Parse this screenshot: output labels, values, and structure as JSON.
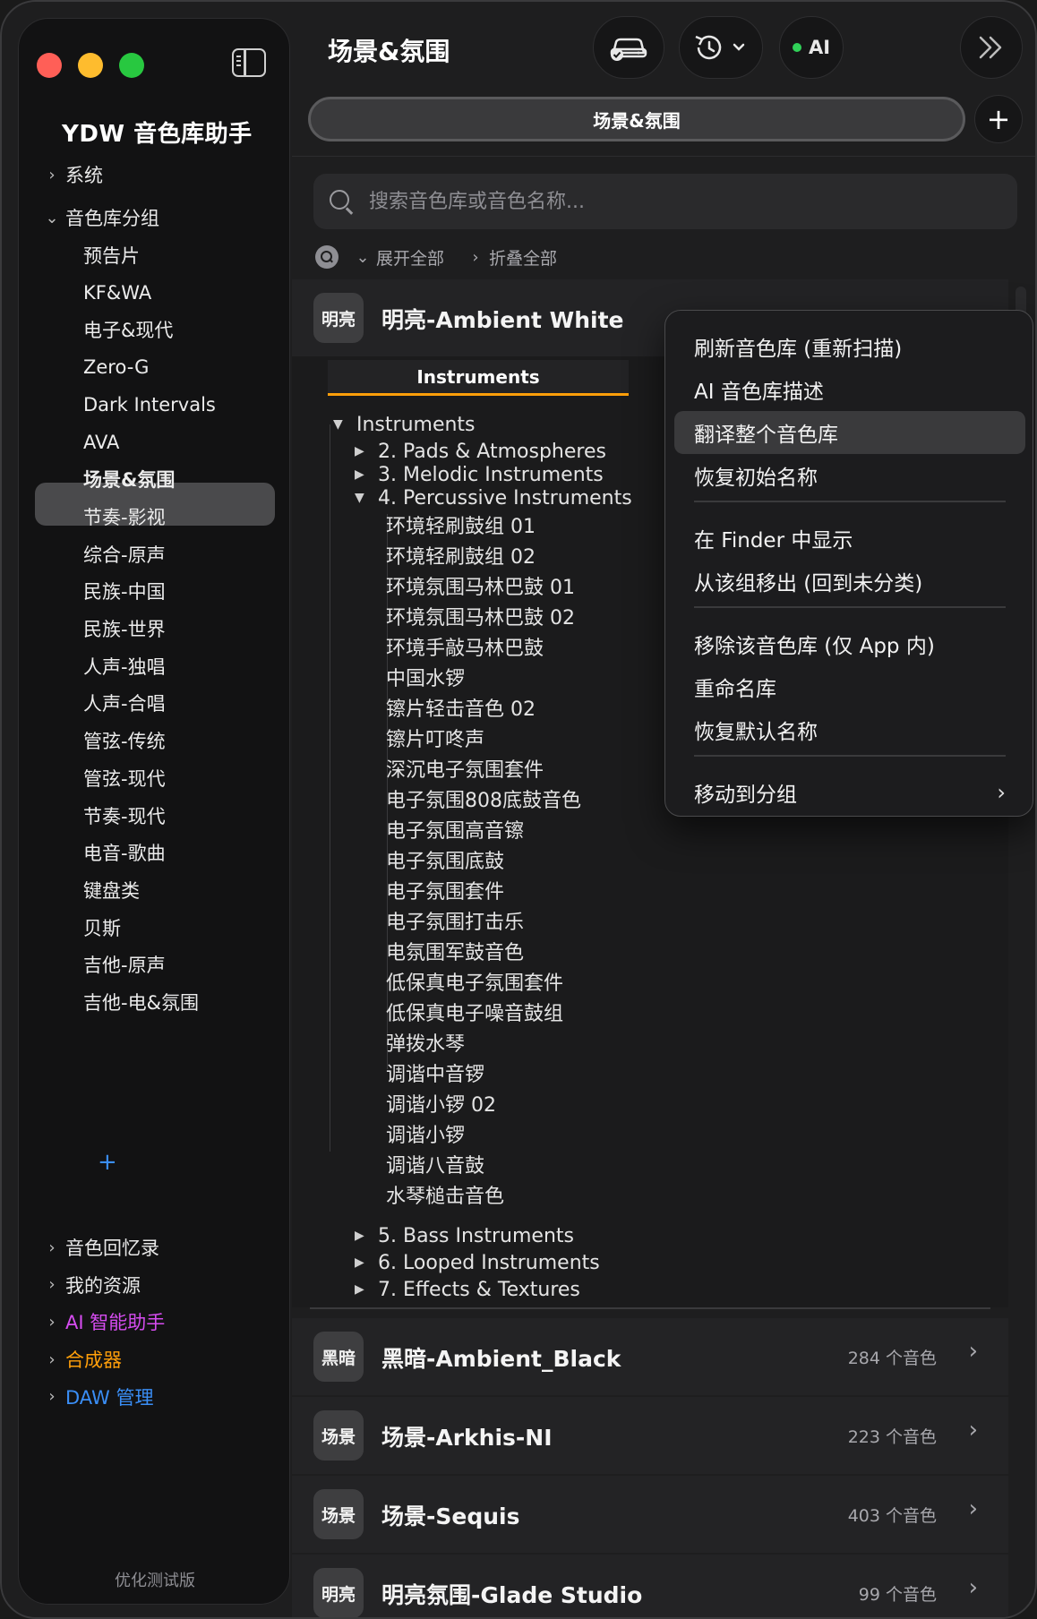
{
  "sidebar": {
    "app_title": "YDW 音色库助手",
    "system": "系统",
    "groups_label": "音色库分组",
    "groups": [
      "预告片",
      "KF&WA",
      "电子&现代",
      "Zero-G",
      "Dark Intervals",
      "AVA",
      "场景&氛围",
      "节奏-影视",
      "综合-原声",
      "民族-中国",
      "民族-世界",
      "人声-独唱",
      "人声-合唱",
      "管弦-传统",
      "管弦-现代",
      "节奏-现代",
      "电音-歌曲",
      "键盘类",
      "贝斯",
      "吉他-原声",
      "吉他-电&氛围"
    ],
    "selected_group": "场景&氛围",
    "add_symbol": "+",
    "sections": [
      {
        "label": "音色回忆录",
        "color": "#e8e8e8"
      },
      {
        "label": "我的资源",
        "color": "#e8e8e8"
      },
      {
        "label": "AI 智能助手",
        "color": "#d64cf0"
      },
      {
        "label": "合成器",
        "color": "#ff9f0a"
      },
      {
        "label": "DAW 管理",
        "color": "#3a8ef6"
      }
    ],
    "footer": "优化测试版"
  },
  "header": {
    "title": "场景&氛围",
    "ai_label": "AI",
    "tab_label": "场景&氛围",
    "add_tab": "+"
  },
  "search": {
    "placeholder": "搜索音色库或音色名称..."
  },
  "filters": {
    "expand_all": "展开全部",
    "collapse_all": "折叠全部"
  },
  "expanded_library": {
    "badge": "明亮",
    "name": "明亮-Ambient White",
    "tab": "Instruments",
    "root": "Instruments",
    "folders_before": [
      "2. Pads & Atmospheres",
      "3. Melodic Instruments"
    ],
    "open_folder": "4. Percussive Instruments",
    "items": [
      "环境轻刷鼓组 01",
      "环境轻刷鼓组 02",
      "环境氛围马林巴鼓 01",
      "环境氛围马林巴鼓 02",
      "环境手敲马林巴鼓",
      "中国水锣",
      "镲片轻击音色 02",
      "镲片叮咚声",
      "深沉电子氛围套件",
      "电子氛围808底鼓音色",
      "电子氛围高音镲",
      "电子氛围底鼓",
      "电子氛围套件",
      "电子氛围打击乐",
      "电氛围军鼓音色",
      "低保真电子氛围套件",
      "低保真电子噪音鼓组",
      "弹拨水琴",
      "调谐中音锣",
      "调谐小锣 02",
      "调谐小锣",
      "调谐八音鼓",
      "水琴槌击音色"
    ],
    "folders_after": [
      "5. Bass Instruments",
      "6. Looped Instruments",
      "7. Effects & Textures"
    ]
  },
  "libraries": [
    {
      "badge": "黑暗",
      "name": "黑暗-Ambient_Black",
      "count": "284 个音色"
    },
    {
      "badge": "场景",
      "name": "场景-Arkhis-NI",
      "count": "223 个音色"
    },
    {
      "badge": "场景",
      "name": "场景-Sequis",
      "count": "403 个音色"
    },
    {
      "badge": "明亮",
      "name": "明亮氛围-Glade Studio",
      "count": "99 个音色"
    }
  ],
  "context_menu": {
    "items": [
      "刷新音色库 (重新扫描)",
      "AI 音色库描述",
      "翻译整个音色库",
      "恢复初始名称",
      "在 Finder 中显示",
      "从该组移出 (回到未分类)",
      "移除该音色库 (仅 App 内)",
      "重命名库",
      "恢复默认名称",
      "移动到分组"
    ],
    "hovered": "翻译整个音色库"
  },
  "icons": {
    "window_close": "close-dot",
    "window_minimize": "minimize-dot",
    "window_zoom": "zoom-dot",
    "sidebar_toggle": "sidebar-toggle-icon",
    "car": "car-check-icon",
    "history": "clock-arrow-icon",
    "more": "double-chevron-right-icon",
    "search": "magnifier-icon"
  },
  "colors": {
    "selected_tab_underline": "#ff9f0a",
    "ai_status": "#30d158",
    "add_group": "#3a8ef6"
  }
}
